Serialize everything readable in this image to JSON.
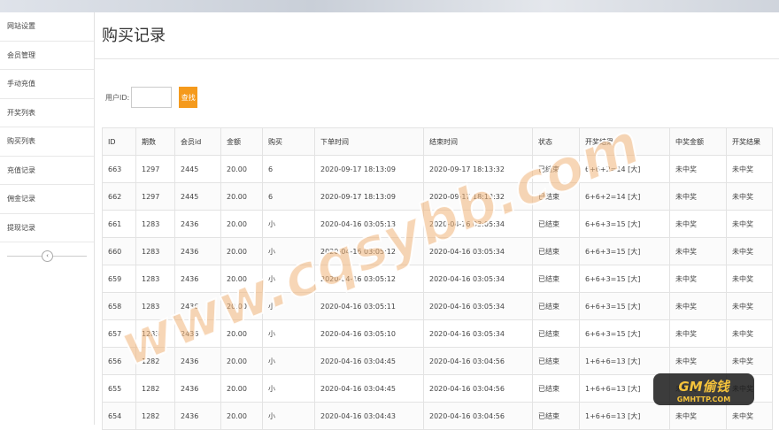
{
  "sidebar": {
    "items": [
      {
        "label": "网站设置"
      },
      {
        "label": "会员管理"
      },
      {
        "label": "手动充值"
      },
      {
        "label": "开奖列表"
      },
      {
        "label": "购买列表"
      },
      {
        "label": "充值记录"
      },
      {
        "label": "佣金记录"
      },
      {
        "label": "提现记录"
      }
    ],
    "collapse_glyph": "‹"
  },
  "page": {
    "title": "购买记录"
  },
  "filter": {
    "label": "用户ID:",
    "input_value": "",
    "search_label": "查找"
  },
  "table": {
    "columns": [
      "ID",
      "期数",
      "会员id",
      "金额",
      "购买",
      "下单时间",
      "结束时间",
      "状态",
      "开奖结果",
      "中奖金额",
      "开奖结果"
    ],
    "rows": [
      [
        "663",
        "1297",
        "2445",
        "20.00",
        "6",
        "2020-09-17 18:13:09",
        "2020-09-17 18:13:32",
        "已结束",
        "6+6+2=14 [大]",
        "未中奖",
        "未中奖"
      ],
      [
        "662",
        "1297",
        "2445",
        "20.00",
        "6",
        "2020-09-17 18:13:09",
        "2020-09-17 18:13:32",
        "已结束",
        "6+6+2=14 [大]",
        "未中奖",
        "未中奖"
      ],
      [
        "661",
        "1283",
        "2436",
        "20.00",
        "小",
        "2020-04-16 03:05:13",
        "2020-04-16 03:05:34",
        "已结束",
        "6+6+3=15 [大]",
        "未中奖",
        "未中奖"
      ],
      [
        "660",
        "1283",
        "2436",
        "20.00",
        "小",
        "2020-04-16 03:05:12",
        "2020-04-16 03:05:34",
        "已结束",
        "6+6+3=15 [大]",
        "未中奖",
        "未中奖"
      ],
      [
        "659",
        "1283",
        "2436",
        "20.00",
        "小",
        "2020-04-16 03:05:12",
        "2020-04-16 03:05:34",
        "已结束",
        "6+6+3=15 [大]",
        "未中奖",
        "未中奖"
      ],
      [
        "658",
        "1283",
        "2436",
        "20.00",
        "小",
        "2020-04-16 03:05:11",
        "2020-04-16 03:05:34",
        "已结束",
        "6+6+3=15 [大]",
        "未中奖",
        "未中奖"
      ],
      [
        "657",
        "1283",
        "2436",
        "20.00",
        "小",
        "2020-04-16 03:05:10",
        "2020-04-16 03:05:34",
        "已结束",
        "6+6+3=15 [大]",
        "未中奖",
        "未中奖"
      ],
      [
        "656",
        "1282",
        "2436",
        "20.00",
        "小",
        "2020-04-16 03:04:45",
        "2020-04-16 03:04:56",
        "已结束",
        "1+6+6=13 [大]",
        "未中奖",
        "未中奖"
      ],
      [
        "655",
        "1282",
        "2436",
        "20.00",
        "小",
        "2020-04-16 03:04:45",
        "2020-04-16 03:04:56",
        "已结束",
        "1+6+6=13 [大]",
        "未中奖",
        "未中奖"
      ],
      [
        "654",
        "1282",
        "2436",
        "20.00",
        "小",
        "2020-04-16 03:04:43",
        "2020-04-16 03:04:56",
        "已结束",
        "1+6+6=13 [大]",
        "未中奖",
        "未中奖"
      ]
    ]
  },
  "watermark": {
    "text": "www.cqsybb.com"
  },
  "logo": {
    "text": "GM偷钱",
    "subtext": "GMHTTP.COM"
  },
  "colors": {
    "accent": "#f59a1c",
    "watermark": "#f0b47a"
  }
}
